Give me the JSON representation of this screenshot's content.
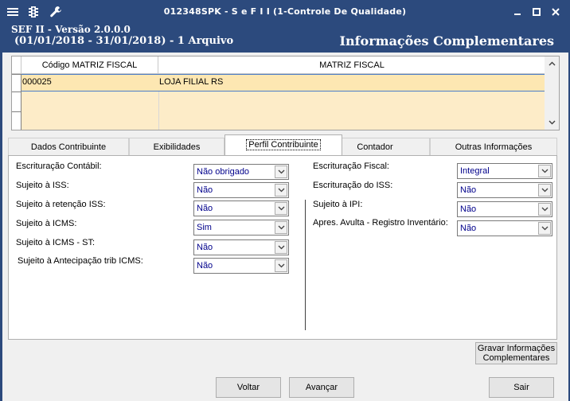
{
  "window": {
    "title": "012348SPK - S e F  I I (1-Controle De Qualidade)",
    "icons": [
      "menu-icon",
      "traffic-light-icon",
      "wrench-icon"
    ],
    "controls": [
      "minimize-icon",
      "maximize-icon",
      "close-icon"
    ]
  },
  "header": {
    "version": "SEF II - Versão 2.0.0.0",
    "period": "(01/01/2018 - 31/01/2018) - 1 Arquivo",
    "section": "Informações Complementares"
  },
  "grid": {
    "columns": [
      "Código MATRIZ FISCAL",
      "MATRIZ FISCAL"
    ],
    "rows": [
      {
        "codigo": "000025",
        "matriz": "LOJA FILIAL RS"
      }
    ]
  },
  "tabs": [
    {
      "label": "Dados Contribuinte",
      "active": false
    },
    {
      "label": "Exibilidades",
      "active": false
    },
    {
      "label": "Perfil Contribuinte",
      "active": true
    },
    {
      "label": "Contador",
      "active": false
    },
    {
      "label": "Outras Informações",
      "active": false
    }
  ],
  "perfil": {
    "left": [
      {
        "label": "Escrituração Contábil:",
        "value": "Não obrigado"
      },
      {
        "label": "Sujeito à ISS:",
        "value": "Não"
      },
      {
        "label": "Sujeito à retenção ISS:",
        "value": "Não"
      },
      {
        "label": "Sujeito à ICMS:",
        "value": "Sim"
      },
      {
        "label": "Sujeito à ICMS - ST:",
        "value": "Não"
      },
      {
        "label": "Sujeito à Antecipação trib ICMS:",
        "value": "Não"
      }
    ],
    "right": [
      {
        "label": "Escrituração Fiscal:",
        "value": "Integral"
      },
      {
        "label": "Escrituração do ISS:",
        "value": "Não"
      },
      {
        "label": "Sujeito à IPI:",
        "value": "Não"
      },
      {
        "label": "Apres. Avulta - Registro Inventário:",
        "value": "Não"
      }
    ]
  },
  "buttons": {
    "save_line1": "Gravar Informações",
    "save_line2": "Complementares",
    "back": "Voltar",
    "next": "Avançar",
    "exit": "Sair"
  }
}
